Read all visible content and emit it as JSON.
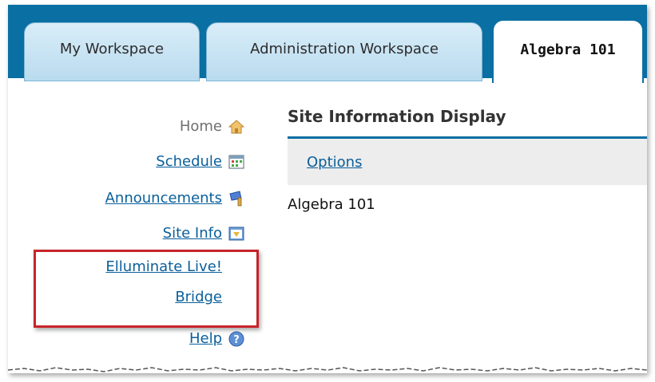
{
  "tabs": [
    {
      "label": "My Workspace",
      "active": false
    },
    {
      "label": "Administration Workspace",
      "active": false
    },
    {
      "label": "Algebra 101",
      "active": true
    }
  ],
  "nav": {
    "home": {
      "label": "Home",
      "icon": "home-icon"
    },
    "schedule": {
      "label": "Schedule",
      "icon": "calendar-icon"
    },
    "announcements": {
      "label": "Announcements",
      "icon": "megaphone-icon"
    },
    "site_info": {
      "label": "Site Info",
      "icon": "site-info-icon"
    },
    "elluminate_line1": "Elluminate Live!",
    "elluminate_line2": "Bridge",
    "help": {
      "label": "Help",
      "icon": "help-icon"
    }
  },
  "panel": {
    "title": "Site Information Display",
    "options_label": "Options",
    "site_name": "Algebra 101"
  },
  "colors": {
    "tabbar": "#0a6fa3",
    "link": "#0a5f9b",
    "highlight": "#c8242b"
  }
}
